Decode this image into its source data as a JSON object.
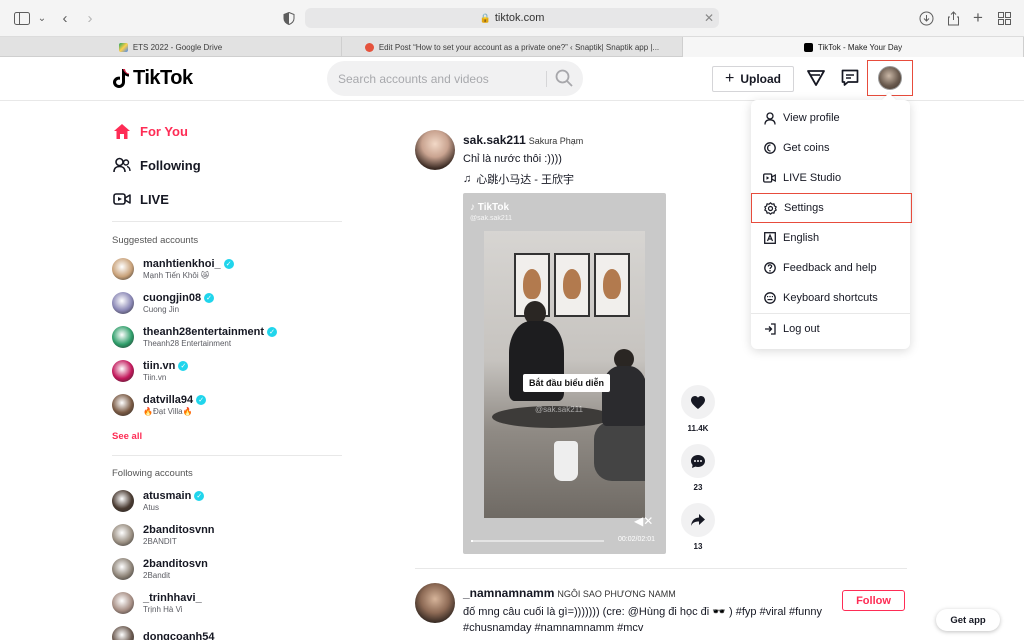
{
  "browser": {
    "url": "tiktok.com",
    "tabs": [
      {
        "label": "ETS 2022 - Google Drive",
        "color": "#f4b400"
      },
      {
        "label": "Edit Post “How to set your account as a private one?” ‹ Snaptik| Snaptik app |...",
        "color": "#e5533d"
      },
      {
        "label": "TikTok - Make Your Day",
        "color": "#000000"
      }
    ]
  },
  "header": {
    "logo": "TikTok",
    "search_placeholder": "Search accounts and videos",
    "upload_label": "Upload"
  },
  "sidebar": {
    "nav": [
      {
        "label": "For You"
      },
      {
        "label": "Following"
      },
      {
        "label": "LIVE"
      }
    ],
    "suggested_title": "Suggested accounts",
    "suggested": [
      {
        "username": "manhtienkhoi_",
        "display": "Mạnh Tiến Khôi 😿",
        "color": "#c9a27a",
        "verified": true
      },
      {
        "username": "cuongjin08",
        "display": "Cuong Jin",
        "color": "#8a87b5",
        "verified": true
      },
      {
        "username": "theanh28entertainment",
        "display": "Theanh28 Entertainment",
        "color": "#2f9e6a",
        "verified": true
      },
      {
        "username": "tiin.vn",
        "display": "Tiin.vn",
        "color": "#c2185b",
        "verified": true
      },
      {
        "username": "datvilla94",
        "display": "🔥Đạt Villa🔥",
        "color": "#7a5a44",
        "verified": true
      }
    ],
    "see_all": "See all",
    "following_title": "Following accounts",
    "following": [
      {
        "username": "atusmain",
        "display": "Atus",
        "color": "#4a3b32",
        "verified": true
      },
      {
        "username": "2banditosvnn",
        "display": "2BANDIT",
        "color": "#9a8f82",
        "verified": false
      },
      {
        "username": "2banditosvn",
        "display": "2Bandit",
        "color": "#8e8478",
        "verified": false
      },
      {
        "username": "_trinhhavi_",
        "display": "Trịnh Hà Vi",
        "color": "#a78f85",
        "verified": false
      },
      {
        "username": "dongcoanh54",
        "display": "",
        "color": "#6b5a50",
        "verified": false
      }
    ]
  },
  "feed": {
    "post1": {
      "username": "sak.sak211",
      "display": "Sakura Phạm",
      "caption": "Chỉ là nước thôi :))))",
      "music": "心跳小马达 - 王欣宇",
      "video": {
        "watermark": "TikTok",
        "watermark_user": "@sak.sak211",
        "overlay_text": "Bắt đầu biểu diễn",
        "overlay_user": "@sak.sak211",
        "time": "00:02/02:01",
        "progress": 0.017
      },
      "likes": "11.4K",
      "comments": "23",
      "shares": "13"
    },
    "post2": {
      "username": "_namnamnamm",
      "display": "NGÔI SAO PHƯƠNG NAMM",
      "caption": "đố mng câu cuối là gì=))))))) (cre: @Hùng đi học đi 🕶️ ) #fyp #viral #funny",
      "caption2": "#chusnamday #namnamnamm #mcv",
      "follow_label": "Follow"
    }
  },
  "menu": {
    "items": [
      {
        "label": "View profile"
      },
      {
        "label": "Get coins"
      },
      {
        "label": "LIVE Studio"
      },
      {
        "label": "Settings"
      },
      {
        "label": "English"
      },
      {
        "label": "Feedback and help"
      },
      {
        "label": "Keyboard shortcuts"
      },
      {
        "label": "Log out"
      }
    ]
  },
  "get_app": "Get app",
  "colors": {
    "brand": "#fe2c55",
    "verified": "#20d5ec",
    "highlight": "#e74c3c"
  }
}
